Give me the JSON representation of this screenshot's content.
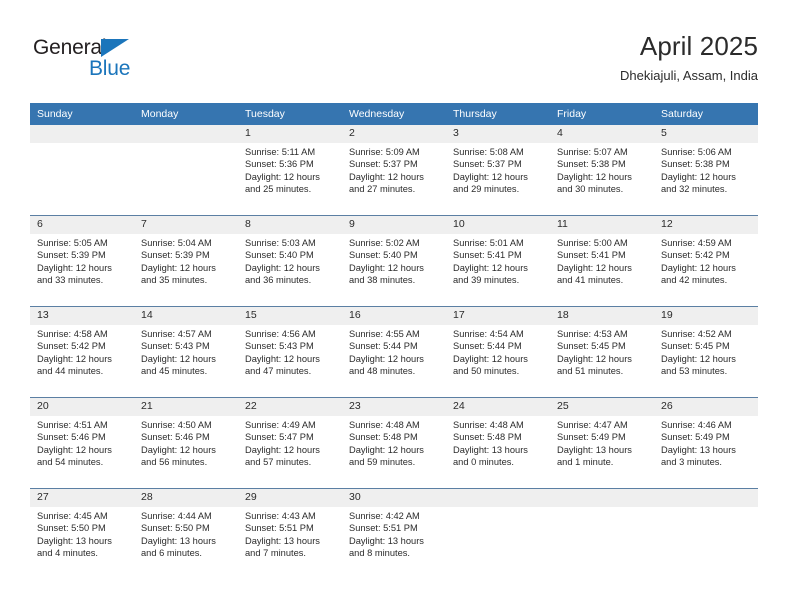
{
  "brand": {
    "name_top": "General",
    "name_bottom": "Blue",
    "triangle_color": "#1b75bb",
    "text_color": "#231f20"
  },
  "header": {
    "title": "April 2025",
    "subtitle": "Dhekiajuli, Assam, India"
  },
  "theme": {
    "header_bg": "#3675b0",
    "header_text": "#ffffff",
    "daynum_strip_bg": "#efefef",
    "cell_bg": "#ffffff",
    "row_divider": "#5b7fa3"
  },
  "weekdays": [
    "Sunday",
    "Monday",
    "Tuesday",
    "Wednesday",
    "Thursday",
    "Friday",
    "Saturday"
  ],
  "weeks": [
    [
      {
        "day": "",
        "sunrise": "",
        "sunset": "",
        "daylight1": "",
        "daylight2": "",
        "empty": true
      },
      {
        "day": "",
        "sunrise": "",
        "sunset": "",
        "daylight1": "",
        "daylight2": "",
        "empty": true
      },
      {
        "day": "1",
        "sunrise": "Sunrise: 5:11 AM",
        "sunset": "Sunset: 5:36 PM",
        "daylight1": "Daylight: 12 hours",
        "daylight2": "and 25 minutes."
      },
      {
        "day": "2",
        "sunrise": "Sunrise: 5:09 AM",
        "sunset": "Sunset: 5:37 PM",
        "daylight1": "Daylight: 12 hours",
        "daylight2": "and 27 minutes."
      },
      {
        "day": "3",
        "sunrise": "Sunrise: 5:08 AM",
        "sunset": "Sunset: 5:37 PM",
        "daylight1": "Daylight: 12 hours",
        "daylight2": "and 29 minutes."
      },
      {
        "day": "4",
        "sunrise": "Sunrise: 5:07 AM",
        "sunset": "Sunset: 5:38 PM",
        "daylight1": "Daylight: 12 hours",
        "daylight2": "and 30 minutes."
      },
      {
        "day": "5",
        "sunrise": "Sunrise: 5:06 AM",
        "sunset": "Sunset: 5:38 PM",
        "daylight1": "Daylight: 12 hours",
        "daylight2": "and 32 minutes."
      }
    ],
    [
      {
        "day": "6",
        "sunrise": "Sunrise: 5:05 AM",
        "sunset": "Sunset: 5:39 PM",
        "daylight1": "Daylight: 12 hours",
        "daylight2": "and 33 minutes."
      },
      {
        "day": "7",
        "sunrise": "Sunrise: 5:04 AM",
        "sunset": "Sunset: 5:39 PM",
        "daylight1": "Daylight: 12 hours",
        "daylight2": "and 35 minutes."
      },
      {
        "day": "8",
        "sunrise": "Sunrise: 5:03 AM",
        "sunset": "Sunset: 5:40 PM",
        "daylight1": "Daylight: 12 hours",
        "daylight2": "and 36 minutes."
      },
      {
        "day": "9",
        "sunrise": "Sunrise: 5:02 AM",
        "sunset": "Sunset: 5:40 PM",
        "daylight1": "Daylight: 12 hours",
        "daylight2": "and 38 minutes."
      },
      {
        "day": "10",
        "sunrise": "Sunrise: 5:01 AM",
        "sunset": "Sunset: 5:41 PM",
        "daylight1": "Daylight: 12 hours",
        "daylight2": "and 39 minutes."
      },
      {
        "day": "11",
        "sunrise": "Sunrise: 5:00 AM",
        "sunset": "Sunset: 5:41 PM",
        "daylight1": "Daylight: 12 hours",
        "daylight2": "and 41 minutes."
      },
      {
        "day": "12",
        "sunrise": "Sunrise: 4:59 AM",
        "sunset": "Sunset: 5:42 PM",
        "daylight1": "Daylight: 12 hours",
        "daylight2": "and 42 minutes."
      }
    ],
    [
      {
        "day": "13",
        "sunrise": "Sunrise: 4:58 AM",
        "sunset": "Sunset: 5:42 PM",
        "daylight1": "Daylight: 12 hours",
        "daylight2": "and 44 minutes."
      },
      {
        "day": "14",
        "sunrise": "Sunrise: 4:57 AM",
        "sunset": "Sunset: 5:43 PM",
        "daylight1": "Daylight: 12 hours",
        "daylight2": "and 45 minutes."
      },
      {
        "day": "15",
        "sunrise": "Sunrise: 4:56 AM",
        "sunset": "Sunset: 5:43 PM",
        "daylight1": "Daylight: 12 hours",
        "daylight2": "and 47 minutes."
      },
      {
        "day": "16",
        "sunrise": "Sunrise: 4:55 AM",
        "sunset": "Sunset: 5:44 PM",
        "daylight1": "Daylight: 12 hours",
        "daylight2": "and 48 minutes."
      },
      {
        "day": "17",
        "sunrise": "Sunrise: 4:54 AM",
        "sunset": "Sunset: 5:44 PM",
        "daylight1": "Daylight: 12 hours",
        "daylight2": "and 50 minutes."
      },
      {
        "day": "18",
        "sunrise": "Sunrise: 4:53 AM",
        "sunset": "Sunset: 5:45 PM",
        "daylight1": "Daylight: 12 hours",
        "daylight2": "and 51 minutes."
      },
      {
        "day": "19",
        "sunrise": "Sunrise: 4:52 AM",
        "sunset": "Sunset: 5:45 PM",
        "daylight1": "Daylight: 12 hours",
        "daylight2": "and 53 minutes."
      }
    ],
    [
      {
        "day": "20",
        "sunrise": "Sunrise: 4:51 AM",
        "sunset": "Sunset: 5:46 PM",
        "daylight1": "Daylight: 12 hours",
        "daylight2": "and 54 minutes."
      },
      {
        "day": "21",
        "sunrise": "Sunrise: 4:50 AM",
        "sunset": "Sunset: 5:46 PM",
        "daylight1": "Daylight: 12 hours",
        "daylight2": "and 56 minutes."
      },
      {
        "day": "22",
        "sunrise": "Sunrise: 4:49 AM",
        "sunset": "Sunset: 5:47 PM",
        "daylight1": "Daylight: 12 hours",
        "daylight2": "and 57 minutes."
      },
      {
        "day": "23",
        "sunrise": "Sunrise: 4:48 AM",
        "sunset": "Sunset: 5:48 PM",
        "daylight1": "Daylight: 12 hours",
        "daylight2": "and 59 minutes."
      },
      {
        "day": "24",
        "sunrise": "Sunrise: 4:48 AM",
        "sunset": "Sunset: 5:48 PM",
        "daylight1": "Daylight: 13 hours",
        "daylight2": "and 0 minutes."
      },
      {
        "day": "25",
        "sunrise": "Sunrise: 4:47 AM",
        "sunset": "Sunset: 5:49 PM",
        "daylight1": "Daylight: 13 hours",
        "daylight2": "and 1 minute."
      },
      {
        "day": "26",
        "sunrise": "Sunrise: 4:46 AM",
        "sunset": "Sunset: 5:49 PM",
        "daylight1": "Daylight: 13 hours",
        "daylight2": "and 3 minutes."
      }
    ],
    [
      {
        "day": "27",
        "sunrise": "Sunrise: 4:45 AM",
        "sunset": "Sunset: 5:50 PM",
        "daylight1": "Daylight: 13 hours",
        "daylight2": "and 4 minutes."
      },
      {
        "day": "28",
        "sunrise": "Sunrise: 4:44 AM",
        "sunset": "Sunset: 5:50 PM",
        "daylight1": "Daylight: 13 hours",
        "daylight2": "and 6 minutes."
      },
      {
        "day": "29",
        "sunrise": "Sunrise: 4:43 AM",
        "sunset": "Sunset: 5:51 PM",
        "daylight1": "Daylight: 13 hours",
        "daylight2": "and 7 minutes."
      },
      {
        "day": "30",
        "sunrise": "Sunrise: 4:42 AM",
        "sunset": "Sunset: 5:51 PM",
        "daylight1": "Daylight: 13 hours",
        "daylight2": "and 8 minutes."
      },
      {
        "day": "",
        "sunrise": "",
        "sunset": "",
        "daylight1": "",
        "daylight2": "",
        "empty": true
      },
      {
        "day": "",
        "sunrise": "",
        "sunset": "",
        "daylight1": "",
        "daylight2": "",
        "empty": true
      },
      {
        "day": "",
        "sunrise": "",
        "sunset": "",
        "daylight1": "",
        "daylight2": "",
        "empty": true
      }
    ]
  ]
}
